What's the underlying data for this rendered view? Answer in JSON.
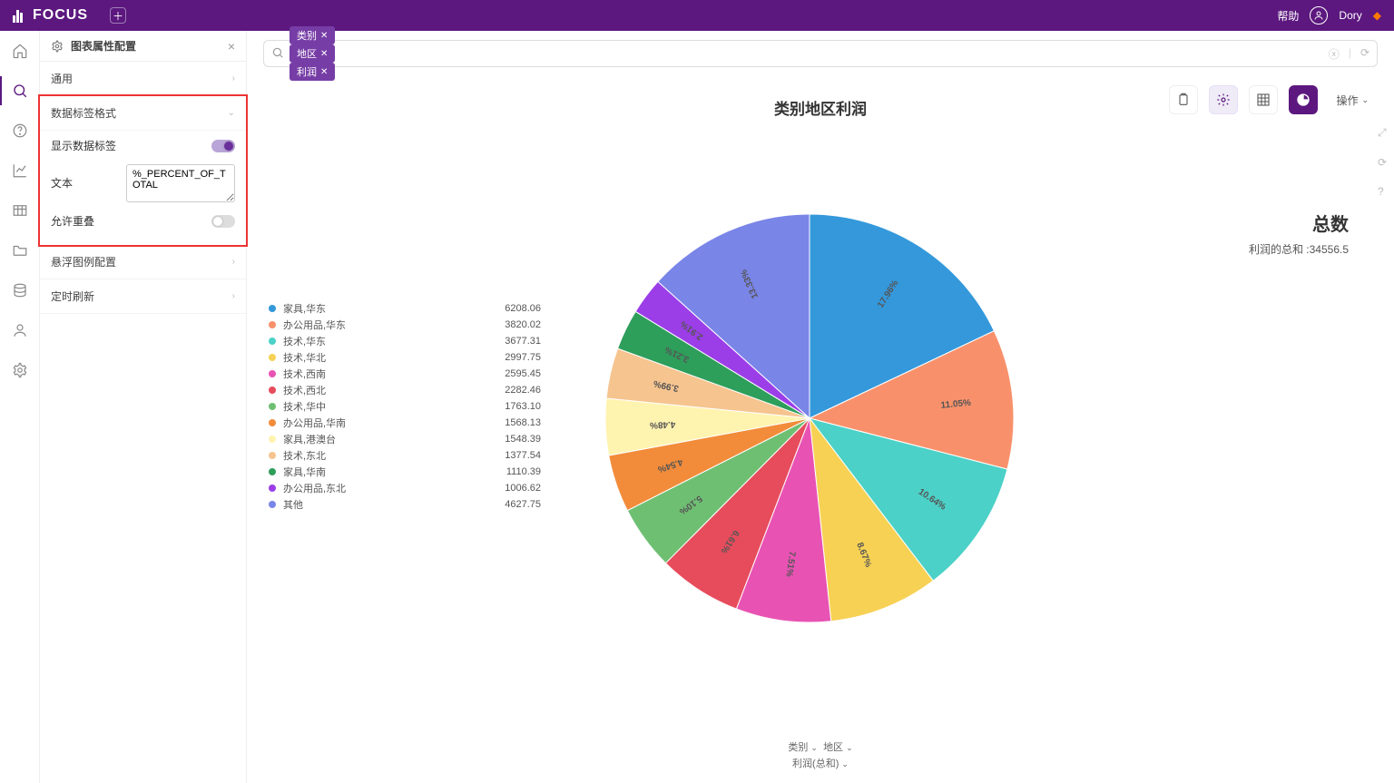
{
  "app": {
    "name": "FOCUS",
    "help": "帮助",
    "user": "Dory"
  },
  "leftRail": [
    "home",
    "search",
    "help",
    "chart",
    "table",
    "folder",
    "db",
    "user",
    "settings"
  ],
  "panel": {
    "title": "图表属性配置",
    "sections": {
      "general": "通用",
      "labelFormat": "数据标签格式",
      "showLabel": "显示数据标签",
      "textLabel": "文本",
      "textValue": "%_PERCENT_OF_TOTAL",
      "allowOverlap": "允许重叠",
      "tooltipLegend": "悬浮图例配置",
      "autoRefresh": "定时刷新"
    }
  },
  "chips": [
    {
      "t": "类别"
    },
    {
      "t": "地区"
    },
    {
      "t": "利润"
    }
  ],
  "toolbar": {
    "op": "操作"
  },
  "chart_title": "类别地区利润",
  "summary": {
    "title": "总数",
    "line": "利润的总和 :34556.5"
  },
  "footer": {
    "l1a": "类别",
    "l1b": "地区",
    "l2": "利润(总和)"
  },
  "chart_data": {
    "type": "pie",
    "title": "类别地区利润",
    "total": 34556.5,
    "series": [
      {
        "name": "家具,华东",
        "value": 6208.06,
        "pct": 17.96,
        "color": "#3498db"
      },
      {
        "name": "办公用品,华东",
        "value": 3820.02,
        "pct": 11.05,
        "color": "#f8916b"
      },
      {
        "name": "技术,华东",
        "value": 3677.31,
        "pct": 10.64,
        "color": "#4bd1c7"
      },
      {
        "name": "技术,华北",
        "value": 2997.75,
        "pct": 8.67,
        "color": "#f7d154"
      },
      {
        "name": "技术,西南",
        "value": 2595.45,
        "pct": 7.51,
        "color": "#e853b3"
      },
      {
        "name": "技术,西北",
        "value": 2282.46,
        "pct": 6.61,
        "color": "#e74c5c"
      },
      {
        "name": "技术,华中",
        "value": 1763.1,
        "pct": 5.1,
        "color": "#6fbf73"
      },
      {
        "name": "办公用品,华南",
        "value": 1568.13,
        "pct": 4.54,
        "color": "#f28c3a"
      },
      {
        "name": "家具,港澳台",
        "value": 1548.39,
        "pct": 4.48,
        "color": "#fff3b0"
      },
      {
        "name": "技术,东北",
        "value": 1377.54,
        "pct": 3.99,
        "color": "#f6c48f"
      },
      {
        "name": "家具,华南",
        "value": 1110.39,
        "pct": 3.21,
        "color": "#2e9e5b"
      },
      {
        "name": "办公用品,东北",
        "value": 1006.62,
        "pct": 2.91,
        "color": "#9b3ee8"
      },
      {
        "name": "其他",
        "value": 4627.75,
        "pct": 13.33,
        "color": "#7a85e8"
      }
    ]
  }
}
